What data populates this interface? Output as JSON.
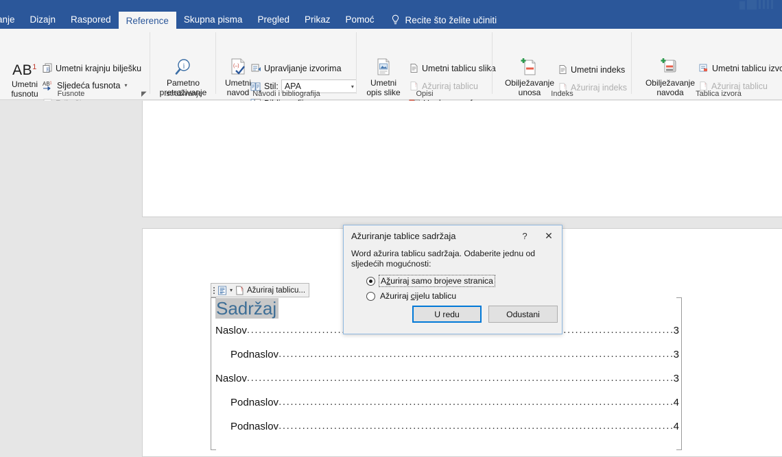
{
  "window": {
    "tabs": [
      {
        "label": "anje",
        "active": false
      },
      {
        "label": "Dizajn",
        "active": false
      },
      {
        "label": "Raspored",
        "active": false
      },
      {
        "label": "Reference",
        "active": true
      },
      {
        "label": "Skupna pisma",
        "active": false
      },
      {
        "label": "Pregled",
        "active": false
      },
      {
        "label": "Prikaz",
        "active": false
      },
      {
        "label": "Pomoć",
        "active": false
      }
    ],
    "tell_me": "Recite što želite učiniti",
    "accent_color": "#2b579a",
    "active_tab_bg": "#f5f5f5"
  },
  "ribbon": {
    "groups": [
      {
        "name": "Fusnote",
        "label": "Fusnote",
        "big_button": {
          "caption_line1": "Umetni",
          "caption_line2": "fusnotu",
          "icon": "ab-footnote-icon"
        },
        "items": [
          {
            "label": "Umetni krajnju bilješku",
            "icon": "endnote-icon",
            "disabled": false,
            "caret": false
          },
          {
            "label": "Sljedeća fusnota",
            "icon": "next-footnote-icon",
            "disabled": false,
            "caret": true
          },
          {
            "label": "Prikaži napomene",
            "icon": "show-notes-icon",
            "disabled": true,
            "caret": false
          }
        ]
      },
      {
        "name": "Istraživanje",
        "label": "Istraživanje",
        "big_button": {
          "caption_line1": "Pametno",
          "caption_line2": "pretraživanje",
          "icon": "smart-lookup-icon"
        },
        "items": []
      },
      {
        "name": "Navodi i bibliografija",
        "label": "Navodi i bibliografija",
        "big_button": {
          "caption_line1": "Umetni",
          "caption_line2": "navod",
          "icon": "insert-citation-icon",
          "caret": true
        },
        "items": [
          {
            "label": "Upravljanje izvorima",
            "icon": "manage-sources-icon",
            "disabled": false,
            "caret": false
          },
          {
            "label": "Stil:",
            "icon": "style-icon",
            "disabled": false,
            "caret": false,
            "combo_value": "APA"
          },
          {
            "label": "Bibliografija",
            "icon": "bibliography-icon",
            "disabled": false,
            "caret": true
          }
        ]
      },
      {
        "name": "Opisi",
        "label": "Opisi",
        "big_button": {
          "caption_line1": "Umetni",
          "caption_line2": "opis slike",
          "icon": "insert-caption-icon"
        },
        "items": [
          {
            "label": "Umetni tablicu slika",
            "icon": "insert-table-of-figures-icon",
            "disabled": false,
            "caret": false
          },
          {
            "label": "Ažuriraj tablicu",
            "icon": "update-table-icon",
            "disabled": true,
            "caret": false
          },
          {
            "label": "Unakrsna referenca",
            "icon": "cross-reference-icon",
            "disabled": false,
            "caret": false
          }
        ]
      },
      {
        "name": "Indeks",
        "label": "Indeks",
        "big_button": {
          "caption_line1": "Obilježavanje",
          "caption_line2": "unosa",
          "icon": "mark-entry-icon"
        },
        "items": [
          {
            "label": "Umetni indeks",
            "icon": "insert-index-icon",
            "disabled": false,
            "caret": false
          },
          {
            "label": "Ažuriraj indeks",
            "icon": "update-index-icon",
            "disabled": true,
            "caret": false
          }
        ]
      },
      {
        "name": "Tablica izvora",
        "label": "Tablica izvora",
        "big_button": {
          "caption_line1": "Obilježavanje",
          "caption_line2": "navoda",
          "icon": "mark-citation-icon"
        },
        "items": [
          {
            "label": "Umetni tablicu izvo",
            "icon": "insert-table-of-authorities-icon",
            "disabled": false,
            "caret": false
          },
          {
            "label": "Ažuriraj tablicu",
            "icon": "update-authorities-icon",
            "disabled": true,
            "caret": false
          }
        ]
      }
    ]
  },
  "document": {
    "toc_control_toolbar": {
      "label": "Ažuriraj tablicu...",
      "dropdown_icon": "toc-options-icon",
      "update_icon": "update-table-warning-icon"
    },
    "toc": {
      "title": "Sadržaj",
      "entries": [
        {
          "text": "Naslov",
          "page": "3",
          "level": 1
        },
        {
          "text": "Podnaslov",
          "page": "3",
          "level": 2
        },
        {
          "text": "Naslov",
          "page": "3",
          "level": 1
        },
        {
          "text": "Podnaslov",
          "page": "4",
          "level": 2
        },
        {
          "text": "Podnaslov",
          "page": "4",
          "level": 2
        }
      ]
    }
  },
  "dialog": {
    "title": "Ažuriranje tablice sadržaja",
    "help_button": "?",
    "close_button": "✕",
    "message": "Word ažurira tablicu sadržaja. Odaberite jednu od sljedećih mogućnosti:",
    "options": [
      {
        "label_pre": "A",
        "label_accel": "ž",
        "label_post": "uriraj samo brojeve stranica",
        "selected": true,
        "focused": true
      },
      {
        "label_pre": "Ažuriraj ",
        "label_accel": "c",
        "label_post": "ijelu tablicu",
        "selected": false,
        "focused": false
      }
    ],
    "ok_label": "U redu",
    "cancel_label": "Odustani",
    "default_border_color": "#0078d7"
  }
}
